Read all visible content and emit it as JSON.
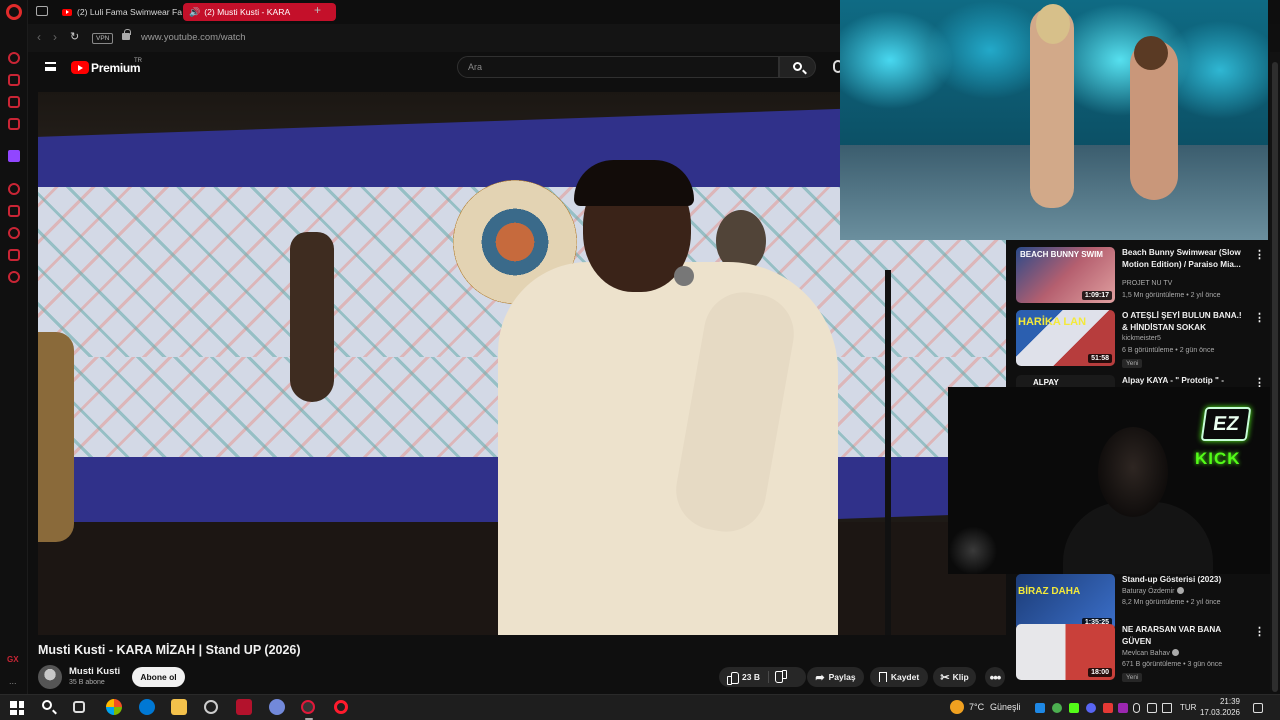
{
  "browser": {
    "tabs": [
      {
        "label": "(2) Luli Fama Swimwear Fa",
        "active": false
      },
      {
        "label": "(2) Musti Kusti - KARA",
        "active": true
      }
    ],
    "url": "www.youtube.com/watch",
    "vpn_label": "VPN"
  },
  "youtube": {
    "brand": "Premium",
    "region": "TR",
    "search_placeholder": "Ara"
  },
  "video": {
    "title": "Musti Kusti - KARA MİZAH  | Stand UP (2026)",
    "channel": "Musti Kusti",
    "subscribers": "35 B abone",
    "subscribe_label": "Abone ol",
    "likes": "23 B",
    "share_label": "Paylaş",
    "save_label": "Kaydet",
    "clip_label": "Klip"
  },
  "recommendations": [
    {
      "title": "Beach Bunny Swimwear (Slow Motion Edition) / Paraiso Mia...",
      "channel": "PROJET NU TV",
      "meta": "1,5 Mn görüntüleme • 2 yıl önce",
      "duration": "1:09:17",
      "thumb_text": "BEACH BUNNY SWIM",
      "is_new": false
    },
    {
      "title": "O ATEŞLİ ŞEYİ BULUN BANA.! & HİNDİSTAN SOKAK LEZZETLE...",
      "channel": "kickmeister5",
      "meta": "6 B görüntüleme • 2 gün önce",
      "duration": "51:58",
      "thumb_text": "HARİKA LAN",
      "is_new": true,
      "new_label": "Yeni"
    },
    {
      "title": "Alpay KAYA - \" Prototip \" -",
      "thumb_text": "ALPAY"
    },
    {
      "title": "Stand-up Gösterisi (2023)",
      "channel": "Baturay Özdemir",
      "verified": true,
      "meta": "8,2 Mn görüntüleme • 2 yıl önce",
      "duration": "1:35:25",
      "thumb_text": "BİRAZ DAHA",
      "is_new": false
    },
    {
      "title": "NE ARARSAN VAR BANA GÜVEN",
      "channel": "Mevlcan Bahav",
      "verified": true,
      "meta": "671 B görüntüleme • 3 gün önce",
      "duration": "18:00",
      "is_new": true,
      "new_label": "Yeni"
    }
  ],
  "kick_overlay": {
    "badge": "EZ",
    "brand": "KICK"
  },
  "taskbar": {
    "weather": "7°C",
    "weather_desc": "Güneşli",
    "language": "TUR",
    "time": "21:39",
    "date": "17.03.2026"
  },
  "opera_sidebar": {
    "gx_label": "GX",
    "more_label": "..."
  },
  "colors": {
    "accent_red": "#c4102a",
    "youtube_red": "#ff0000",
    "kick_green": "#53fc18",
    "background": "#0f0f0f"
  }
}
